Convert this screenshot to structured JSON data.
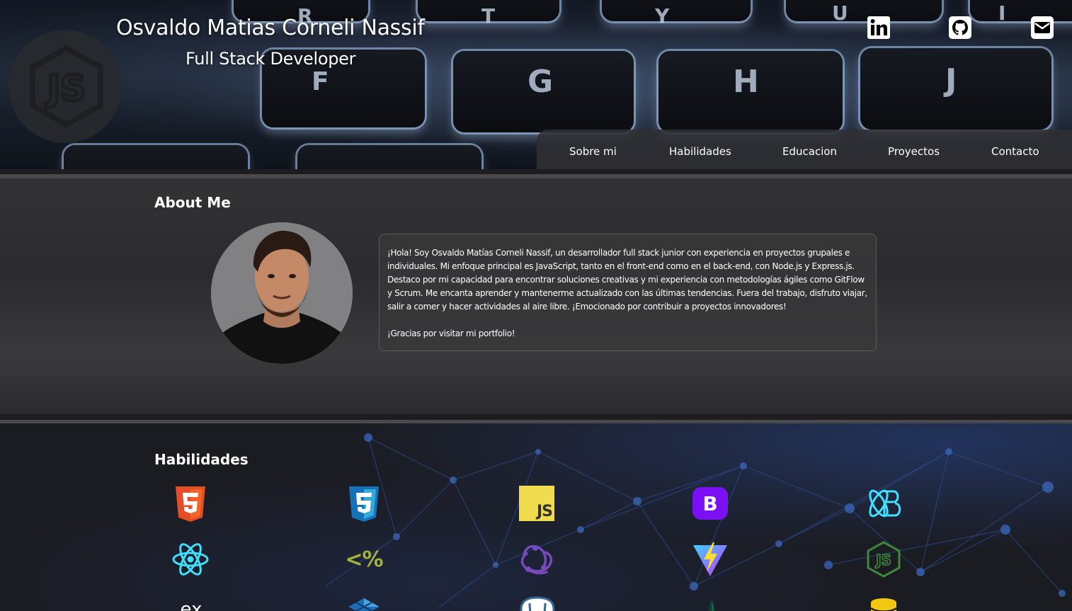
{
  "header": {
    "name": "Osvaldo Matias Corneli Nassif",
    "role": "Full Stack Developer",
    "logo_icon": "nodejs-logo-icon",
    "keyboard_letters": [
      "R",
      "T",
      "Y",
      "U",
      "I",
      "F",
      "G",
      "H",
      "J"
    ],
    "social": [
      {
        "name": "linkedin-icon"
      },
      {
        "name": "github-icon"
      },
      {
        "name": "email-icon"
      }
    ]
  },
  "nav": {
    "items": [
      {
        "label": "Sobre mi"
      },
      {
        "label": "Habilidades"
      },
      {
        "label": "Educacion"
      },
      {
        "label": "Proyectos"
      },
      {
        "label": "Contacto"
      }
    ]
  },
  "about": {
    "title": "About Me",
    "paragraph1": "¡Hola! Soy Osvaldo Matías Corneli Nassif, un desarrollador full stack junior con experiencia en proyectos grupales e individuales. Mi enfoque principal es JavaScript, tanto en el front-end como en el back-end, con Node.js y Express.js. Destaco por mi capacidad para encontrar soluciones creativas y mi experiencia con metodologías ágiles como GitFlow y Scrum. Me encanta aprender y mantenerme actualizado con las últimas tendencias. Fuera del trabajo, disfruto viajar, salir a comer y hacer actividades al aire libre. ¡Emocionado por contribuir a proyectos innovadores!",
    "paragraph2": "¡Gracias por visitar mi portfolio!",
    "avatar_icon": "profile-photo"
  },
  "skills": {
    "title": "Habilidades",
    "icons": [
      "html5-icon",
      "css3-icon",
      "javascript-icon",
      "bootstrap-icon",
      "react-bootstrap-icon",
      "react-icon",
      "ejs-icon",
      "redux-icon",
      "vite-icon",
      "nodejs-icon",
      "express-icon",
      "sequelize-icon",
      "postgresql-icon",
      "mongodb-icon",
      "database-icon"
    ],
    "labels": {
      "js": "JS",
      "bootstrap": "B",
      "ejs": "<%",
      "express": "ex"
    }
  },
  "colors": {
    "html5": "#e44d26",
    "css3": "#1572b6",
    "javascript": "#f0db4f",
    "bootstrap": "#7b10f5",
    "react": "#61dafb",
    "ejs": "#a3b33a",
    "redux": "#764abc",
    "vite": "#646cff",
    "nodejs": "#3c873a",
    "database": "#f2c811"
  }
}
